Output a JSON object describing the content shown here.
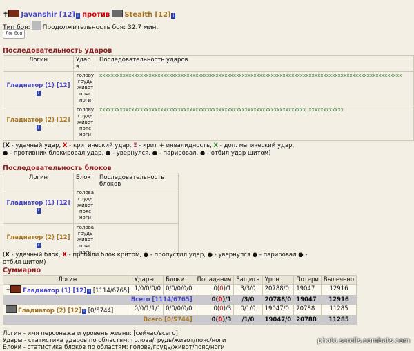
{
  "header": {
    "player1": "Javanshir",
    "player1_level": "[12]",
    "vs": "против",
    "player2": "Stealth",
    "player2_level": "[12]",
    "battle_type_label": "Тип боя:",
    "duration_label": "Продолжительность боя:",
    "duration": "32.7 мин.",
    "log_button": "Лог боя"
  },
  "strikes": {
    "section_title": "Последовательность ударов",
    "col_login": "Логин",
    "col_zone": "Удар в",
    "col_seq": "Последовательность ударов",
    "zones": [
      "голову",
      "грудь",
      "живот",
      "пояс",
      "ноги"
    ],
    "rows": [
      {
        "name": "Гладиатор (1) [12]",
        "seq": "xxxxxxxxxxxxxxxxxxxxxxxxxxxxxxxxxxxxxxxxxxxxxxxxxxxxxxxxxxxxxxxxxxxxxxxxxxxxxxxxxxxxxxxxxxxxxxxxxxxxxxxx"
      },
      {
        "name": "Гладиатор (2) [12]",
        "seq": "xxxxxxxxxxxxxxxxxxxxxxxxxxxxxxxxxxxxxxxxxxxxxxxxxxxxxxxxxxxxxxxxxxxxxxx xxxxxxxxxxxx"
      }
    ],
    "legend_line1": " - удачный удар, ",
    "legend_crit": " - критический удар, ",
    "legend_crit_inv": " - крит + инвалидность, ",
    "legend_magic": " - доп. магический удар,",
    "legend_line2": " - противник блокировал удар, ",
    "legend_dodge": " - увернулся, ",
    "legend_parry": " - парировал, ",
    "legend_shield": " - отбил удар щитом)"
  },
  "blocks": {
    "section_title": "Последовательность блоков",
    "col_login": "Логин",
    "col_zone": "Блок",
    "col_seq": "Последовательность блоков",
    "zones": [
      "голова",
      "грудь",
      "живот",
      "пояс",
      "ноги"
    ],
    "rows": [
      {
        "name": "Гладиатор (1) [12]"
      },
      {
        "name": "Гладиатор (2) [12]"
      }
    ],
    "legend_a": " - удачный блок, ",
    "legend_b": " - пробили блок критом, ",
    "legend_c": " - пропустил удар, ",
    "legend_d": " - увернулся ",
    "legend_e": " - парировал ",
    "legend_f": " - отбил щитом)"
  },
  "summary": {
    "section_title": "Суммарно",
    "headers": [
      "Логин",
      "Удары",
      "Блоки",
      "Попадания",
      "Защита",
      "Урон",
      "Потери",
      "Вылечено"
    ],
    "rows": [
      {
        "name": "Гладиатор (1) [12]",
        "hp": "[1114/6765]",
        "hits": "1/0/0/0/0",
        "blocks": "0/0/0/0/0",
        "hit_a": "0(",
        "hit_b": "0",
        "hit_c": ")/1",
        "def": "3/3/0",
        "dmg": "20788/0",
        "loss": "19047",
        "heal": "12916"
      },
      {
        "total": "Всего [1114/6765]",
        "hit_a": "0(",
        "hit_b": "0",
        "hit_c": ")/1",
        "def": "/3/0",
        "dmg": "20788/0",
        "loss": "19047",
        "heal": "12916"
      },
      {
        "name": "Гладиатор (2) [12]",
        "hp": "[0/5744]",
        "hits": "0/0/1/1/1",
        "blocks": "0/0/0/0/0",
        "hit_a": "0(",
        "hit_b": "0",
        "hit_c": ")/3",
        "def": "0/1/0",
        "dmg": "19047/0",
        "loss": "20788",
        "heal": "11285"
      },
      {
        "total": "Всего [0/5744]",
        "hit_a": "0(",
        "hit_b": "0",
        "hit_c": ")/3",
        "def": "/1/0",
        "dmg": "19047/0",
        "loss": "20788",
        "heal": "11285"
      }
    ],
    "note1": "Логин - имя персонажа и уровень жизни: [сейчас/всего]",
    "note2": "Удары - статистика ударов по областям: голова/грудь/живот/пояс/ноги",
    "note3": "Блоки - статистика блоков по областям: голова/грудь/живот/пояс/ноги"
  },
  "watermark": "photo.scrolls.combats.com"
}
